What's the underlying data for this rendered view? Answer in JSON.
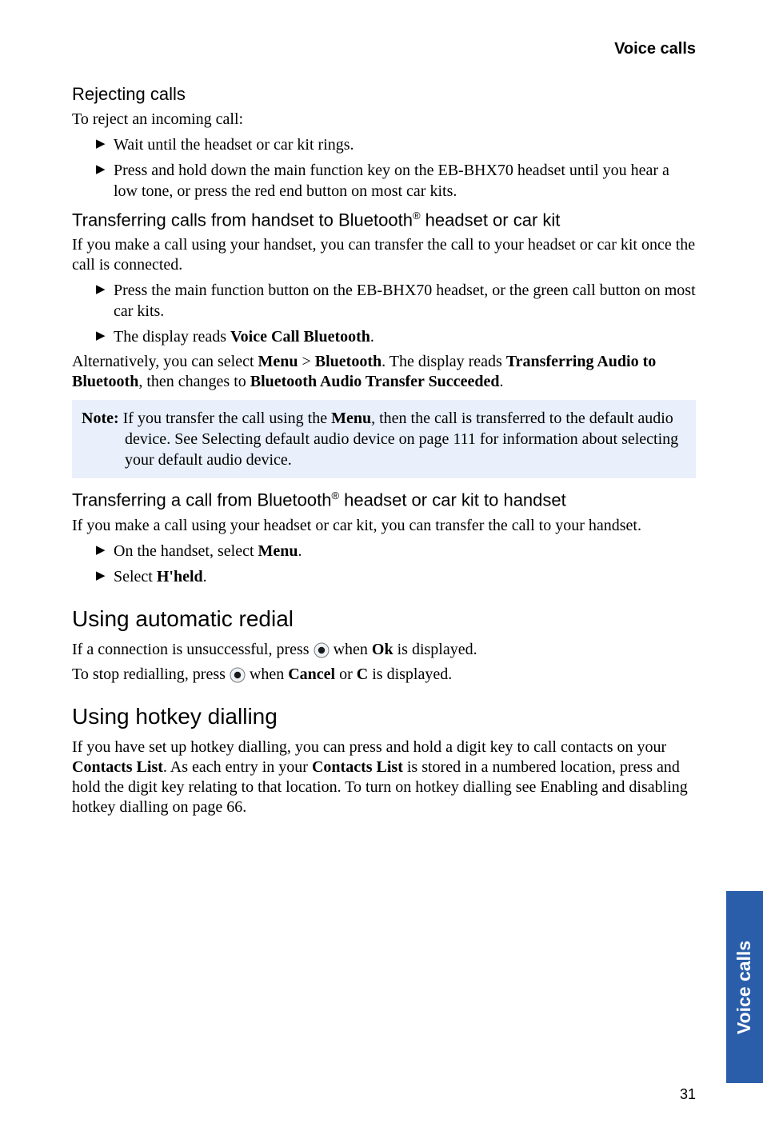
{
  "header": {
    "section": "Voice calls"
  },
  "s1": {
    "title": "Rejecting calls",
    "intro": "To reject an incoming call:",
    "items": [
      "Wait until the headset or car kit rings.",
      "Press and hold down the main function key on the EB-BHX70 headset until you hear a low tone, or press the red end button on most car kits."
    ]
  },
  "s2": {
    "title_pre": "Transferring calls from handset to Bluetooth",
    "title_post": " headset or car kit",
    "intro": "If you make a call using your handset, you can transfer the call to your headset or car kit once the call is connected.",
    "items": [
      {
        "text": "Press the main function button on the EB-BHX70 headset, or the green call button on most car kits."
      },
      {
        "pre": "The display reads ",
        "b1": "Voice Call Bluetooth",
        "post": "."
      }
    ],
    "alt_p1": "Alternatively, you can select ",
    "alt_b1": "Menu",
    "alt_gt": " > ",
    "alt_b2": "Bluetooth",
    "alt_mid": ". The display reads ",
    "alt_b3": "Transferring Audio to Bluetooth",
    "alt_mid2": ", then changes to ",
    "alt_b4": "Bluetooth Audio Transfer Succeeded",
    "alt_end": "."
  },
  "note": {
    "label": "Note:",
    "pre": " If you transfer the call using the ",
    "b1": "Menu",
    "post": ", then the call is transferred to the default audio device. See Selecting default audio device on page 111 for information about selecting your default audio device."
  },
  "s3": {
    "title_pre": "Transferring a call from Bluetooth",
    "title_post": " headset or car kit to handset",
    "intro": "If you make a call using your headset or car kit, you can transfer the call to your handset.",
    "items": [
      {
        "pre": "On the handset, select ",
        "b1": "Menu",
        "post": "."
      },
      {
        "pre": "Select ",
        "b1": "H'held",
        "post": "."
      }
    ]
  },
  "s4": {
    "title": "Using automatic redial",
    "p1_pre": "If a connection is unsuccessful, press ",
    "p1_mid": " when ",
    "p1_b": "Ok",
    "p1_post": " is displayed.",
    "p2_pre": "To stop redialling, press ",
    "p2_mid": " when ",
    "p2_b1": "Cancel",
    "p2_or": " or ",
    "p2_b2": "C",
    "p2_post": " is displayed."
  },
  "s5": {
    "title": "Using hotkey dialling",
    "p_pre": "If you have set up hotkey dialling, you can press and hold a digit key to call contacts on your ",
    "p_b1": "Contacts List",
    "p_mid": ". As each entry in your ",
    "p_b2": "Contacts List",
    "p_post": " is stored in a numbered location, press and hold the digit key relating to that location. To turn on hotkey dialling see Enabling and disabling hotkey dialling on page 66."
  },
  "sidetab": "Voice calls",
  "page": "31",
  "reg": "®"
}
